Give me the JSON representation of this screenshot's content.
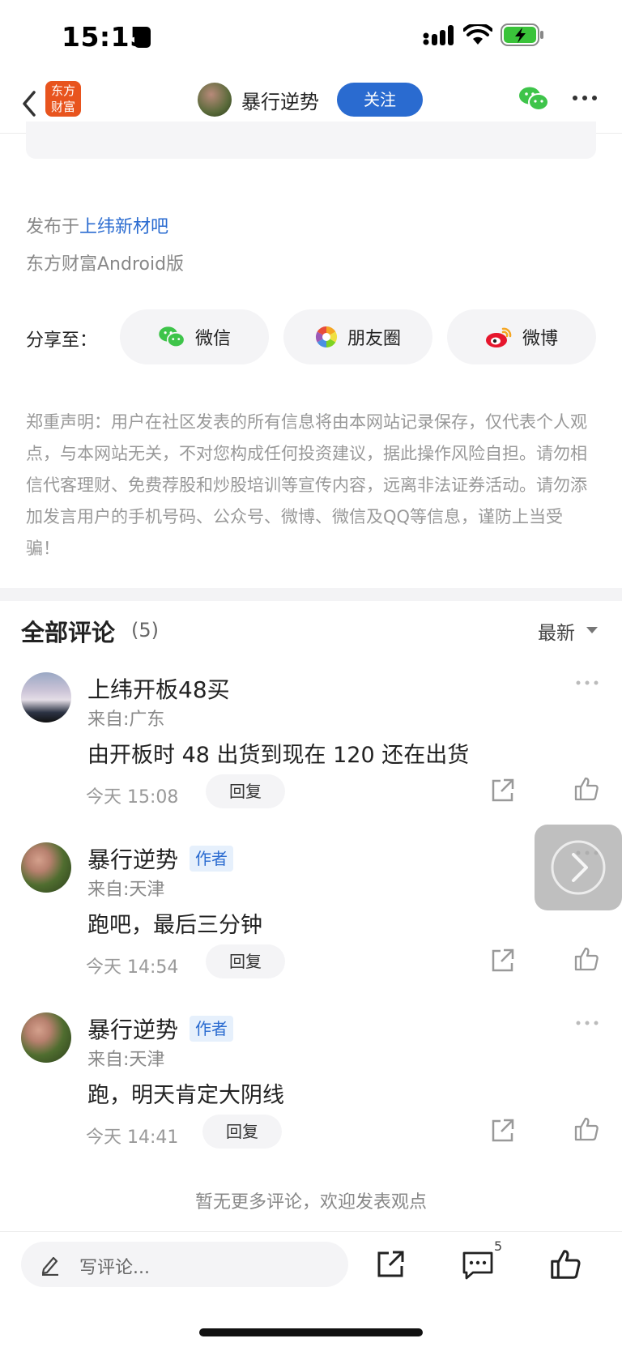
{
  "status": {
    "time": "15:15"
  },
  "header": {
    "logo_line1": "东方",
    "logo_line2": "财富",
    "author_name": "暴行逆势",
    "follow_label": "关注"
  },
  "post": {
    "published_prefix": "发布于",
    "published_board": "上纬新材吧",
    "client": "东方财富Android版"
  },
  "share": {
    "label": "分享至：",
    "buttons": [
      {
        "label": "微信",
        "icon": "wechat-icon"
      },
      {
        "label": "朋友圈",
        "icon": "moments-icon"
      },
      {
        "label": "微博",
        "icon": "weibo-icon"
      }
    ]
  },
  "disclaimer": "郑重声明：用户在社区发表的所有信息将由本网站记录保存，仅代表个人观点，与本网站无关，不对您构成任何投资建议，据此操作风险自担。请勿相信代客理财、免费荐股和炒股培训等宣传内容，远离非法证券活动。请勿添加发言用户的手机号码、公众号、微博、微信及QQ等信息，谨防上当受骗！",
  "comments_section": {
    "title": "全部评论",
    "count": "(5)",
    "sort": "最新",
    "reply_label": "回复",
    "items": [
      {
        "user": "上纬开板48买",
        "tag": "",
        "location": "来自:广东",
        "text": "由开板时 48 出货到现在 120 还在出货",
        "time": "今天 15:08"
      },
      {
        "user": "暴行逆势",
        "tag": "作者",
        "location": "来自:天津",
        "text": "跑吧，最后三分钟",
        "time": "今天 14:54"
      },
      {
        "user": "暴行逆势",
        "tag": "作者",
        "location": "来自:天津",
        "text": "跑，明天肯定大阴线",
        "time": "今天 14:41"
      }
    ],
    "no_more": "暂无更多评论，欢迎发表观点"
  },
  "bottom_bar": {
    "input_placeholder": "写评论...",
    "comment_count": "5"
  },
  "colors": {
    "accent": "#2a6bd0",
    "brand": "#e8541e",
    "battery": "#3ac33a"
  }
}
